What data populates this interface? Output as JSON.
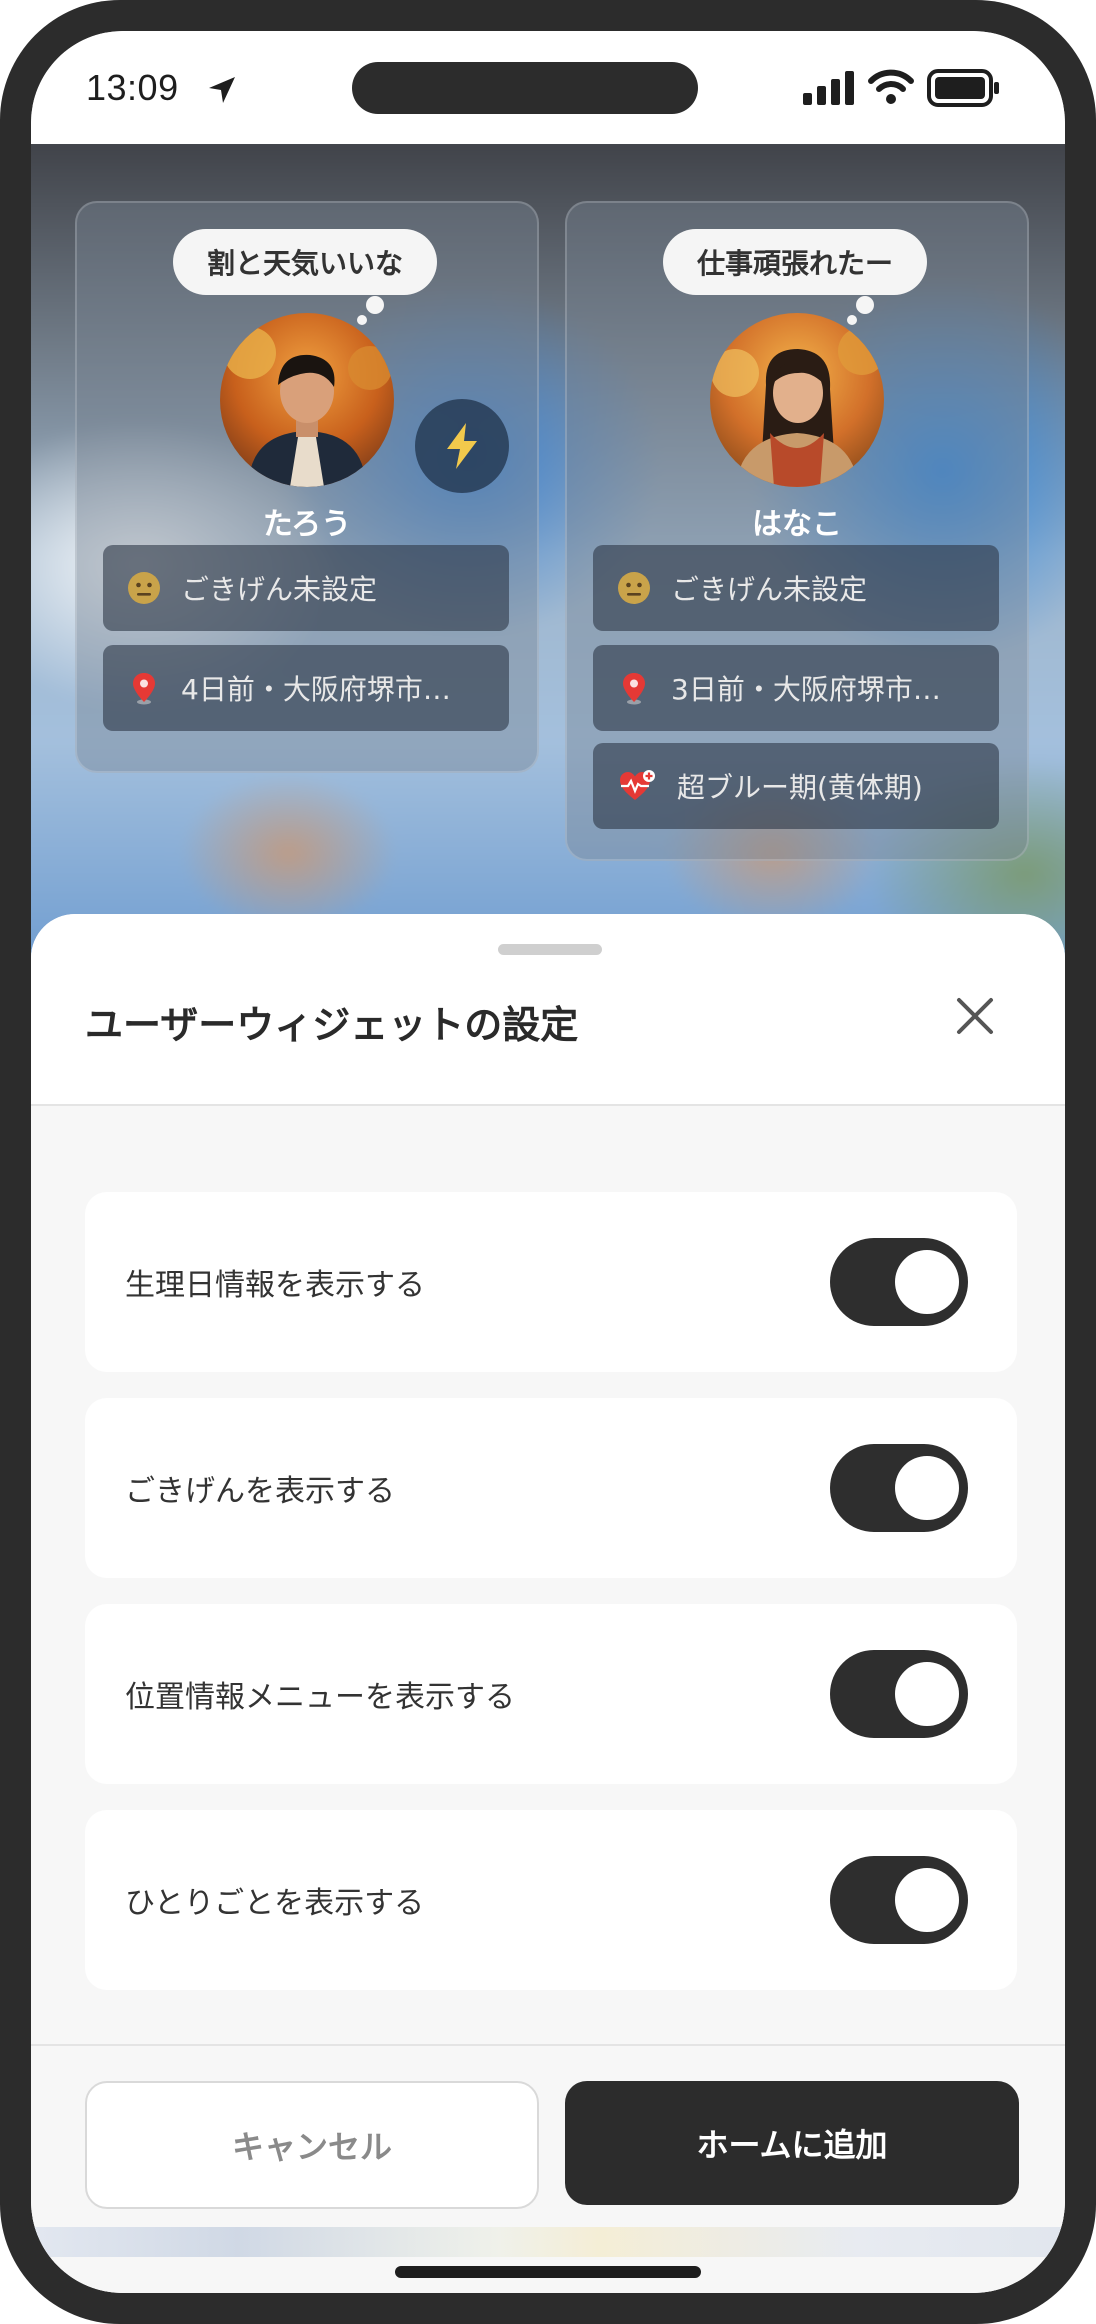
{
  "status_bar": {
    "time": "13:09"
  },
  "widgets": [
    {
      "bubble": "割と天気いいな",
      "name": "たろう",
      "mood": "ごきげん未設定",
      "location": "4日前・大阪府堺市…"
    },
    {
      "bubble": "仕事頑張れたー",
      "name": "はなこ",
      "mood": "ごきげん未設定",
      "location": "3日前・大阪府堺市…",
      "cycle": "超ブルー期(黄体期)"
    }
  ],
  "sheet": {
    "title": "ユーザーウィジェットの設定",
    "settings": [
      {
        "label": "生理日情報を表示する",
        "on": true
      },
      {
        "label": "ごきげんを表示する",
        "on": true
      },
      {
        "label": "位置情報メニューを表示する",
        "on": true
      },
      {
        "label": "ひとりごとを表示する",
        "on": true
      }
    ],
    "cancel_label": "キャンセル",
    "add_label": "ホームに追加"
  },
  "colors": {
    "accent_dark": "#2c2c2c",
    "bolt": "#f2c94c",
    "pin": "#e53935"
  }
}
